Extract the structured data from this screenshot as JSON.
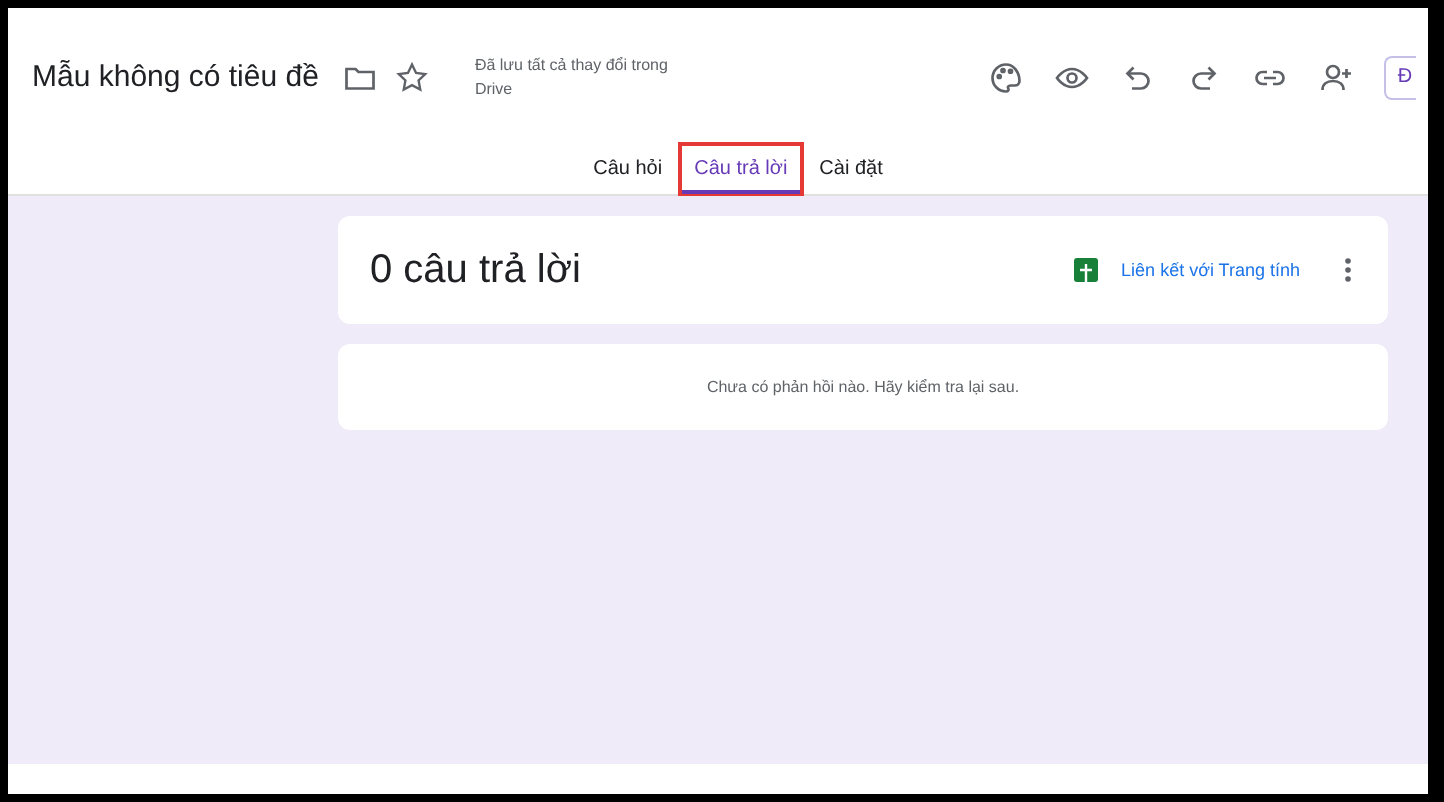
{
  "header": {
    "title": "Mẫu không có tiêu đề",
    "save_status": "Đã lưu tất cả thay đổi trong Drive",
    "action_button": "Đ"
  },
  "tabs": [
    {
      "label": "Câu hỏi",
      "selected": false,
      "highlighted": false
    },
    {
      "label": "Câu trả lời",
      "selected": true,
      "highlighted": true
    },
    {
      "label": "Cài đặt",
      "selected": false,
      "highlighted": false
    }
  ],
  "summary_card": {
    "title": "0 câu trả lời",
    "link": "Liên kết với Trang tính"
  },
  "empty_card": {
    "message": "Chưa có phản hồi nào. Hãy kiểm tra lại sau."
  }
}
